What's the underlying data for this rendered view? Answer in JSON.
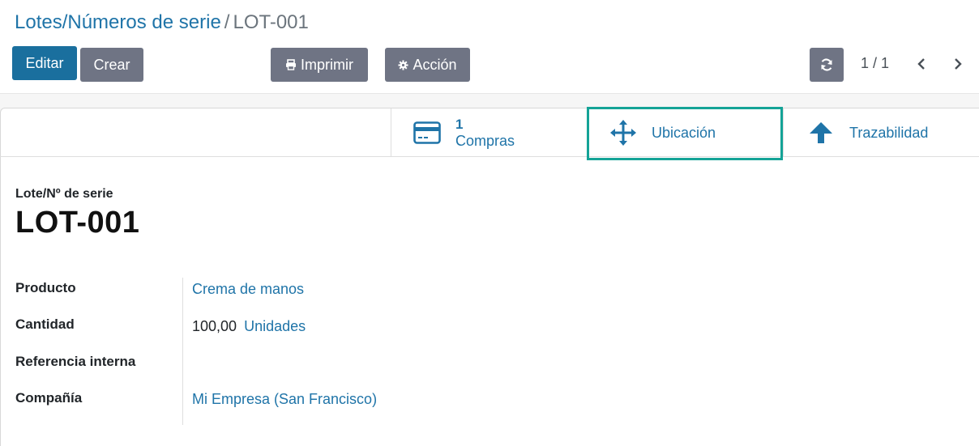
{
  "breadcrumb": {
    "parent": "Lotes/Números de serie",
    "separator": "/",
    "current": "LOT-001"
  },
  "toolbar": {
    "edit_label": "Editar",
    "create_label": "Crear",
    "print_label": "Imprimir",
    "action_label": "Acción"
  },
  "pager": {
    "value": "1 / 1"
  },
  "smart_buttons": {
    "purchases": {
      "value": "1",
      "label": "Compras"
    },
    "location": {
      "label": "Ubicación"
    },
    "traceability": {
      "label": "Trazabilidad"
    }
  },
  "form": {
    "title_label": "Lote/Nº de serie",
    "title": "LOT-001",
    "fields": {
      "product_label": "Producto",
      "product_value": "Crema de manos",
      "quantity_label": "Cantidad",
      "quantity_value": "100,00",
      "quantity_uom": "Unidades",
      "internal_ref_label": "Referencia interna",
      "internal_ref_value": "",
      "company_label": "Compañía",
      "company_value": "Mi Empresa (San Francisco)"
    }
  },
  "colors": {
    "link": "#1f74a8",
    "primary_button": "#1a6f9e",
    "secondary_button": "#6f7484",
    "highlight": "#14a397"
  },
  "icons": {
    "print": "print-icon",
    "action": "gear-icon",
    "refresh": "refresh-icon",
    "prev": "chevron-left-icon",
    "next": "chevron-right-icon",
    "purchases": "credit-card-icon",
    "location": "arrows-move-icon",
    "traceability": "arrow-up-icon"
  }
}
